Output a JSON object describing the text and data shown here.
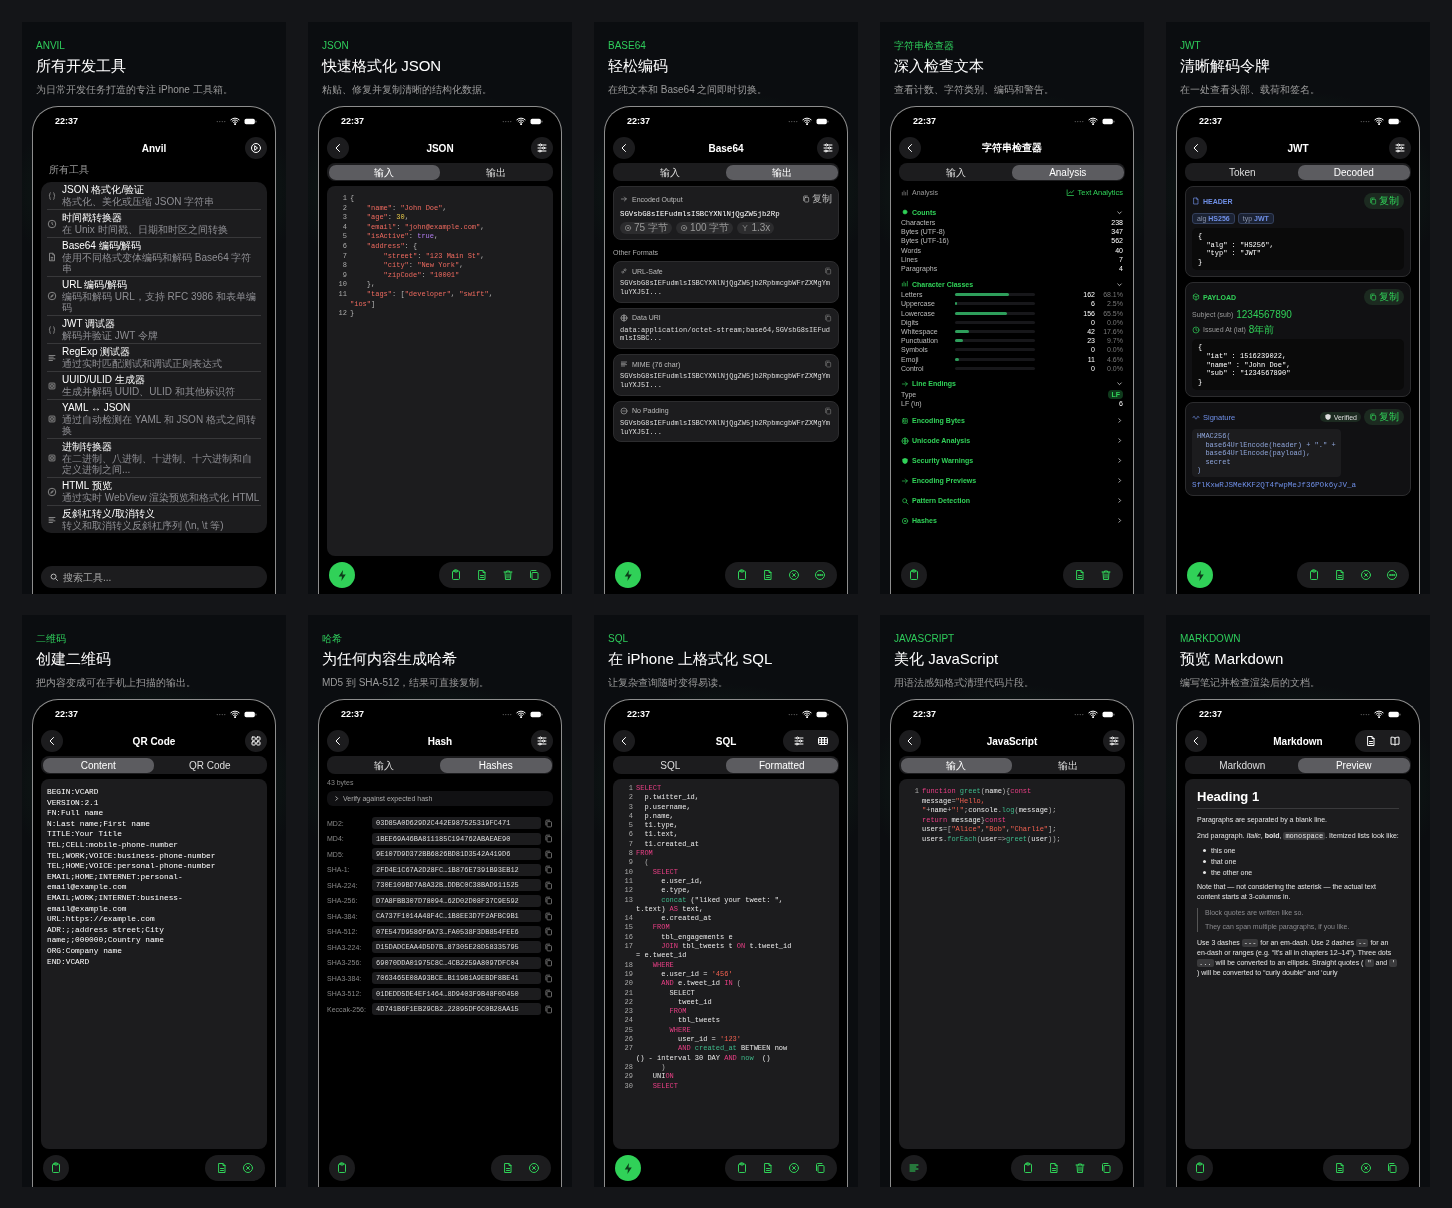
{
  "panels": [
    {
      "kind": "tools",
      "eyebrow": "ANVIL",
      "title": "所有开发工具",
      "subtitle": "为日常开发任务打造的专注 iPhone 工具箱。",
      "phone": {
        "time": "22:37",
        "title": "Anvil",
        "section": "所有工具",
        "tools": [
          {
            "title": "JSON 格式化/验证",
            "subtitle": "格式化、美化或压缩 JSON 字符串"
          },
          {
            "title": "时间戳转换器",
            "subtitle": "在 Unix 时间戳、日期和时区之间转换"
          },
          {
            "title": "Base64 编码/解码",
            "subtitle": "使用不同格式变体编码和解码 Base64 字符串"
          },
          {
            "title": "URL 编码/解码",
            "subtitle": "编码和解码 URL，支持 RFC 3986 和表单编码"
          },
          {
            "title": "JWT 调试器",
            "subtitle": "解码并验证 JWT 令牌"
          },
          {
            "title": "RegExp 测试器",
            "subtitle": "通过实时匹配测试和调试正则表达式"
          },
          {
            "title": "UUID/ULID 生成器",
            "subtitle": "生成并解码 UUID、ULID 和其他标识符"
          },
          {
            "title": "YAML ↔ JSON",
            "subtitle": "通过自动检测在 YAML 和 JSON 格式之间转换"
          },
          {
            "title": "进制转换器",
            "subtitle": "在二进制、八进制、十进制、十六进制和自定义进制之间..."
          },
          {
            "title": "HTML 预览",
            "subtitle": "通过实时 WebView 渲染预览和格式化 HTML"
          },
          {
            "title": "反斜杠转义/取消转义",
            "subtitle": "转义和取消转义反斜杠序列 (\\n, \\t 等)"
          }
        ],
        "search": {
          "placeholder": "搜索工具..."
        }
      }
    },
    {
      "kind": "json",
      "eyebrow": "JSON",
      "title": "快速格式化 JSON",
      "subtitle": "粘贴、修复并复制清晰的结构化数据。",
      "phone": {
        "time": "22:37",
        "title": "JSON",
        "tabs": [
          {
            "label": "输入",
            "selected": true
          },
          {
            "label": "输出",
            "selected": false
          }
        ],
        "code": [
          {
            "n": "1",
            "tokens": [
              {
                "kind": "punc",
                "text": "{"
              }
            ]
          },
          {
            "n": "2",
            "tokens": [
              {
                "kind": "key",
                "text": "    \"name\""
              },
              {
                "kind": "punc",
                "text": ": "
              },
              {
                "kind": "str",
                "text": "\"John Doe\""
              },
              {
                "kind": "punc",
                "text": ","
              }
            ]
          },
          {
            "n": "3",
            "tokens": [
              {
                "kind": "key",
                "text": "    \"age\""
              },
              {
                "kind": "punc",
                "text": ": "
              },
              {
                "kind": "num",
                "text": "30"
              },
              {
                "kind": "punc",
                "text": ","
              }
            ]
          },
          {
            "n": "4",
            "tokens": [
              {
                "kind": "key",
                "text": "    \"email\""
              },
              {
                "kind": "punc",
                "text": ": "
              },
              {
                "kind": "str",
                "text": "\"john@example.com\""
              },
              {
                "kind": "punc",
                "text": ","
              }
            ]
          },
          {
            "n": "5",
            "tokens": [
              {
                "kind": "key",
                "text": "    \"isActive\""
              },
              {
                "kind": "punc",
                "text": ": "
              },
              {
                "kind": "bool",
                "text": "true"
              },
              {
                "kind": "punc",
                "text": ","
              }
            ]
          },
          {
            "n": "6",
            "tokens": [
              {
                "kind": "key",
                "text": "    \"address\""
              },
              {
                "kind": "punc",
                "text": ": {"
              }
            ]
          },
          {
            "n": "7",
            "tokens": [
              {
                "kind": "key",
                "text": "        \"street\""
              },
              {
                "kind": "punc",
                "text": ": "
              },
              {
                "kind": "str",
                "text": "\"123 Main St\""
              },
              {
                "kind": "punc",
                "text": ","
              }
            ]
          },
          {
            "n": "8",
            "tokens": [
              {
                "kind": "key",
                "text": "        \"city\""
              },
              {
                "kind": "punc",
                "text": ": "
              },
              {
                "kind": "str",
                "text": "\"New York\""
              },
              {
                "kind": "punc",
                "text": ","
              }
            ]
          },
          {
            "n": "9",
            "tokens": [
              {
                "kind": "key",
                "text": "        \"zipCode\""
              },
              {
                "kind": "punc",
                "text": ": "
              },
              {
                "kind": "str",
                "text": "\"10001\""
              }
            ]
          },
          {
            "n": "10",
            "tokens": [
              {
                "kind": "punc",
                "text": "    },"
              }
            ]
          },
          {
            "n": "11",
            "tokens": [
              {
                "kind": "key",
                "text": "    \"tags\""
              },
              {
                "kind": "punc",
                "text": ": ["
              },
              {
                "kind": "str",
                "text": "\"developer\""
              },
              {
                "kind": "punc",
                "text": ", "
              },
              {
                "kind": "str",
                "text": "\"swift\""
              },
              {
                "kind": "punc",
                "text": ","
              }
            ]
          },
          {
            "tokens": [
              {
                "kind": "str",
                "text": "\"ios\""
              },
              {
                "kind": "punc",
                "text": "]"
              }
            ]
          },
          {
            "n": "12",
            "tokens": [
              {
                "kind": "punc",
                "text": "}"
              }
            ]
          }
        ]
      }
    },
    {
      "kind": "base64",
      "eyebrow": "BASE64",
      "title": "轻松编码",
      "subtitle": "在纯文本和 Base64 之间即时切换。",
      "phone": {
        "time": "22:37",
        "title": "Base64",
        "tabs": [
          {
            "label": "输入",
            "selected": false
          },
          {
            "label": "输出",
            "selected": true
          }
        ],
        "output": {
          "label": "Encoded Output",
          "copy": "复制",
          "value": "SGVsbG8sIEFudmlsISBCYXNlNjQgZW5jb2Rp",
          "chips": [
            "75 字节",
            "100 字节",
            "1.3x"
          ]
        },
        "section": "Other Formats",
        "formats": [
          {
            "label": "URL-Safe",
            "value": "SGVsbG8sIEFudmlsISBCYXNlNjQgZW5jb2RpbmcgbWFrZXMgYmluYXJ5I..."
          },
          {
            "label": "Data URI",
            "value": "data:application/octet-stream;base64,SGVsbG8sIEFudmlsISBC..."
          },
          {
            "label": "MIME (76 char)",
            "value": "SGVsbG8sIEFudmlsISBCYXNlNjQgZW5jb2RpbmcgbWFrZXMgYmluYXJ5I..."
          },
          {
            "label": "No Padding",
            "value": "SGVsbG8sIEFudmlsISBCYXNlNjQgZW5jb2RpbmcgbWFrZXMgYmluYXJ5I..."
          }
        ]
      }
    },
    {
      "kind": "inspector",
      "eyebrow": "字符串检查器",
      "title": "深入检查文本",
      "subtitle": "查看计数、字符类别、编码和警告。",
      "phone": {
        "time": "22:37",
        "title": "字符串检查器",
        "tabs": [
          {
            "label": "输入",
            "selected": false
          },
          {
            "label": "Analysis",
            "selected": true
          }
        ],
        "header": {
          "label": "Analysis",
          "action": "Text Analytics"
        },
        "sections": [
          {
            "kind": "counts",
            "title": "Counts",
            "expanded": true,
            "rows": [
              {
                "label": "Characters",
                "value": "238"
              },
              {
                "label": "Bytes (UTF-8)",
                "value": "347"
              },
              {
                "label": "Bytes (UTF-16)",
                "value": "562"
              },
              {
                "label": "Words",
                "value": "40"
              },
              {
                "label": "Lines",
                "value": "7"
              },
              {
                "label": "Paragraphs",
                "value": "4"
              }
            ]
          },
          {
            "kind": "classes",
            "title": "Character Classes",
            "expanded": true,
            "rows": [
              {
                "label": "Letters",
                "count": "162",
                "percent": "68.1%",
                "level": 0.681
              },
              {
                "label": "Uppercase",
                "count": "6",
                "percent": "2.5%",
                "level": 0.025
              },
              {
                "label": "Lowercase",
                "count": "156",
                "percent": "65.5%",
                "level": 0.655
              },
              {
                "label": "Digits",
                "count": "0",
                "percent": "0.0%"
              },
              {
                "label": "Whitespace",
                "count": "42",
                "percent": "17.6%",
                "level": 0.176
              },
              {
                "label": "Punctuation",
                "count": "23",
                "percent": "9.7%",
                "level": 0.097
              },
              {
                "label": "Symbols",
                "count": "0",
                "percent": "0.0%"
              },
              {
                "label": "Emoji",
                "count": "11",
                "percent": "4.6%",
                "level": 0.046
              },
              {
                "label": "Control",
                "count": "0",
                "percent": "0.0%"
              }
            ]
          },
          {
            "kind": "endings",
            "title": "Line Endings",
            "expanded": true,
            "rows": [
              {
                "kind": "badge",
                "label": "Type",
                "value": "LF"
              },
              {
                "kind": "value",
                "label": "LF (\\n)",
                "value": "6"
              }
            ]
          },
          {
            "kind": "more",
            "title": "Encoding Bytes",
            "expanded": false
          },
          {
            "kind": "more",
            "title": "Unicode Analysis",
            "expanded": false
          },
          {
            "kind": "more",
            "title": "Security Warnings",
            "expanded": false
          },
          {
            "kind": "more",
            "title": "Encoding Previews",
            "expanded": false
          },
          {
            "kind": "more",
            "title": "Pattern Detection",
            "expanded": false
          },
          {
            "kind": "more",
            "title": "Hashes",
            "expanded": false
          }
        ]
      }
    },
    {
      "kind": "jwt",
      "eyebrow": "JWT",
      "title": "清晰解码令牌",
      "subtitle": "在一处查看头部、载荷和签名。",
      "phone": {
        "time": "22:37",
        "title": "JWT",
        "tabs": [
          {
            "label": "Token",
            "selected": false
          },
          {
            "label": "Decoded",
            "selected": true
          }
        ],
        "cards": [
          {
            "kind": "header",
            "title": "HEADER",
            "copy": "复制",
            "chips": [
              {
                "key": "alg",
                "value": "HS256"
              },
              {
                "key": "typ",
                "value": "JWT"
              }
            ],
            "code": [
              "{",
              "  \"alg\" : \"HS256\",",
              "  \"typ\" : \"JWT\"",
              "}"
            ]
          },
          {
            "kind": "payload",
            "title": "PAYLOAD",
            "copy": "复制",
            "claims": [
              {
                "kind": "plain",
                "label": "Subject (sub)",
                "value": "1234567890"
              },
              {
                "kind": "time",
                "label": "Issued At (iat)",
                "value": "8年前"
              }
            ],
            "code": [
              "{",
              "  \"iat\" : 1516239022,",
              "  \"name\" : \"John Doe\",",
              "  \"sub\" : \"1234567890\"",
              "}"
            ]
          },
          {
            "kind": "signature",
            "title": "Signature",
            "badge": "Verified",
            "copy": "复制",
            "formula": [
              "HMAC256(",
              "  base64UrlEncode(header) + \".\" +",
              "  base64UrlEncode(payload),",
              "  secret",
              ")"
            ],
            "signature": "SflKxwRJSMeKKF2QT4fwpMeJf36POk6yJV_a"
          }
        ]
      }
    },
    {
      "kind": "qr",
      "eyebrow": "二维码",
      "title": "创建二维码",
      "subtitle": "把内容变成可在手机上扫描的输出。",
      "phone": {
        "time": "22:37",
        "title": "QR Code",
        "tabs": [
          {
            "label": "Content",
            "selected": true
          },
          {
            "label": "QR Code",
            "selected": false
          }
        ],
        "text": [
          "BEGIN:VCARD",
          "VERSION:2.1",
          "FN:Full name",
          "N:Last name;First name",
          "TITLE:Your Title",
          "TEL;CELL:mobile-phone-number",
          "TEL;WORK;VOICE:business-phone-number",
          "TEL;HOME;VOICE:personal-phone-number",
          "EMAIL;HOME;INTERNET:personal-",
          "email@example.com",
          "EMAIL;WORK;INTERNET:business-",
          "email@example.com",
          "URL:https://example.com",
          "ADR:;;address street;City",
          "name;;000000;Country name",
          "ORG:Company name",
          "END:VCARD"
        ]
      }
    },
    {
      "kind": "hash",
      "eyebrow": "哈希",
      "title": "为任何内容生成哈希",
      "subtitle": "MD5 到 SHA-512，结果可直接复制。",
      "phone": {
        "time": "22:37",
        "title": "Hash",
        "tabs": [
          {
            "label": "输入",
            "selected": false
          },
          {
            "label": "Hashes",
            "selected": true
          }
        ],
        "size": "43 bytes",
        "verify": {
          "label": "Verify against expected hash",
          "expanded": false
        },
        "hashes": [
          {
            "algorithm": "MD2:",
            "value": "03D85A0D629D2C442E987525319FC471"
          },
          {
            "algorithm": "MD4:",
            "value": "1BEE69A46BA811185C194762ABAEAE90"
          },
          {
            "algorithm": "MD5:",
            "value": "9E107D9D372BB6826BD81D3542A419D6"
          },
          {
            "algorithm": "SHA-1:",
            "value": "2FD4E1C67A2D28FC…1B876E7391B93EB12"
          },
          {
            "algorithm": "SHA-224:",
            "value": "730E109BD7A8A32B…DDBC0C38BAD911525"
          },
          {
            "algorithm": "SHA-256:",
            "value": "D7A8FBB307D78094…62D02D08F37C9E592"
          },
          {
            "algorithm": "SHA-384:",
            "value": "CA737F1014A48F4C…1B8EE3D7F2AFBC9B1"
          },
          {
            "algorithm": "SHA-512:",
            "value": "07E547D9586F6A73…FA0538F3DB854FEE6"
          },
          {
            "algorithm": "SHA3-224:",
            "value": "D15DADCEAA4D5D7B…87305E28D58335795"
          },
          {
            "algorithm": "SHA3-256:",
            "value": "69070DDA01975C8C…4CB2259A8097DFC04"
          },
          {
            "algorithm": "SHA3-384:",
            "value": "7063465E08A93BCE…B119B1A9EBDF8BE41"
          },
          {
            "algorithm": "SHA3-512:",
            "value": "01DEDD5DE4EF1464…8D9403F9B48F0D450"
          },
          {
            "algorithm": "Keccak-256:",
            "value": "4D741B6F1EB29CB2…22895DF6C0B28AA15"
          }
        ]
      }
    },
    {
      "kind": "sql",
      "eyebrow": "SQL",
      "title": "在 iPhone 上格式化 SQL",
      "subtitle": "让复杂查询随时变得易读。",
      "phone": {
        "time": "22:37",
        "title": "SQL",
        "tabs": [
          {
            "label": "SQL",
            "selected": false
          },
          {
            "label": "Formatted",
            "selected": true
          }
        ],
        "code": [
          {
            "n": "1",
            "tokens": [
              {
                "kind": "kw",
                "text": "SELECT"
              }
            ]
          },
          {
            "n": "2",
            "tokens": [
              {
                "kind": "plain",
                "text": "  p.twitter_id,"
              }
            ]
          },
          {
            "n": "3",
            "tokens": [
              {
                "kind": "plain",
                "text": "  p.username,"
              }
            ]
          },
          {
            "n": "4",
            "tokens": [
              {
                "kind": "plain",
                "text": "  p.name,"
              }
            ]
          },
          {
            "n": "5",
            "tokens": [
              {
                "kind": "plain",
                "text": "  t1.type,"
              }
            ]
          },
          {
            "n": "6",
            "tokens": [
              {
                "kind": "plain",
                "text": "  t1.text,"
              }
            ]
          },
          {
            "n": "7",
            "tokens": [
              {
                "kind": "plain",
                "text": "  t1.created_at"
              }
            ]
          },
          {
            "n": "8",
            "tokens": [
              {
                "kind": "kw",
                "text": "FROM"
              }
            ]
          },
          {
            "n": "9",
            "tokens": [
              {
                "kind": "punc",
                "text": "  ("
              }
            ]
          },
          {
            "n": "10",
            "tokens": [
              {
                "kind": "kw",
                "text": "    SELECT"
              }
            ]
          },
          {
            "n": "11",
            "tokens": [
              {
                "kind": "plain",
                "text": "      e.user_id,"
              }
            ]
          },
          {
            "n": "12",
            "tokens": [
              {
                "kind": "plain",
                "text": "      e.type,"
              }
            ]
          },
          {
            "n": "13",
            "tokens": [
              {
                "kind": "fn",
                "text": "      concat"
              },
              {
                "kind": "plain",
                "text": " (\"liked your tweet: \","
              }
            ]
          },
          {
            "tokens": [
              {
                "kind": "plain",
                "text": "t.text) "
              },
              {
                "kind": "kw",
                "text": "AS"
              },
              {
                "kind": "plain",
                "text": " text,"
              }
            ]
          },
          {
            "n": "14",
            "tokens": [
              {
                "kind": "plain",
                "text": "      e.created_at"
              }
            ]
          },
          {
            "n": "15",
            "tokens": [
              {
                "kind": "kw",
                "text": "    FROM"
              }
            ]
          },
          {
            "n": "16",
            "tokens": [
              {
                "kind": "plain",
                "text": "      tbl_engagements e"
              }
            ]
          },
          {
            "n": "17",
            "tokens": [
              {
                "kind": "kw",
                "text": "      JOIN"
              },
              {
                "kind": "plain",
                "text": " tbl_tweets t "
              },
              {
                "kind": "kw",
                "text": "ON"
              },
              {
                "kind": "plain",
                "text": " t.tweet_id"
              }
            ]
          },
          {
            "tokens": [
              {
                "kind": "plain",
                "text": "= e.tweet_id"
              }
            ]
          },
          {
            "n": "18",
            "tokens": [
              {
                "kind": "kw",
                "text": "    WHERE"
              }
            ]
          },
          {
            "n": "19",
            "tokens": [
              {
                "kind": "plain",
                "text": "      e.user_id = "
              },
              {
                "kind": "sqlstr",
                "text": "'456'"
              }
            ]
          },
          {
            "n": "20",
            "tokens": [
              {
                "kind": "kw",
                "text": "      AND"
              },
              {
                "kind": "plain",
                "text": " e.tweet_id "
              },
              {
                "kind": "kw",
                "text": "IN"
              },
              {
                "kind": "punc",
                "text": " ("
              }
            ]
          },
          {
            "n": "21",
            "tokens": [
              {
                "kind": "plain",
                "text": "        SELECT"
              }
            ]
          },
          {
            "n": "22",
            "tokens": [
              {
                "kind": "plain",
                "text": "          tweet_id"
              }
            ]
          },
          {
            "n": "23",
            "tokens": [
              {
                "kind": "kw",
                "text": "        FROM"
              }
            ]
          },
          {
            "n": "24",
            "tokens": [
              {
                "kind": "plain",
                "text": "          tbl_tweets"
              }
            ]
          },
          {
            "n": "25",
            "tokens": [
              {
                "kind": "kw",
                "text": "        WHERE"
              }
            ]
          },
          {
            "n": "26",
            "tokens": [
              {
                "kind": "plain",
                "text": "          user_id = "
              },
              {
                "kind": "sqlstr",
                "text": "'123'"
              }
            ]
          },
          {
            "n": "27",
            "tokens": [
              {
                "kind": "kw",
                "text": "          AND"
              },
              {
                "kind": "fn",
                "text": " created_at"
              },
              {
                "kind": "plain",
                "text": " BETWEEN now"
              }
            ]
          },
          {
            "tokens": [
              {
                "kind": "plain",
                "text": "() - interval 30 DAY "
              },
              {
                "kind": "kw",
                "text": "AND"
              },
              {
                "kind": "fn",
                "text": " now"
              },
              {
                "kind": "plain",
                "text": "  ()"
              }
            ]
          },
          {
            "n": "28",
            "tokens": [
              {
                "kind": "punc",
                "text": "      )"
              }
            ]
          },
          {
            "n": "29",
            "tokens": [
              {
                "kind": "plain",
                "text": "    UNI"
              },
              {
                "kind": "kw",
                "text": "ON"
              }
            ]
          },
          {
            "n": "30",
            "tokens": [
              {
                "kind": "kw",
                "text": "    SELECT"
              }
            ]
          }
        ]
      }
    },
    {
      "kind": "js",
      "eyebrow": "JAVASCRIPT",
      "title": "美化 JavaScript",
      "subtitle": "用语法感知格式清理代码片段。",
      "phone": {
        "time": "22:37",
        "title": "JavaScript",
        "tabs": [
          {
            "label": "输入",
            "selected": true
          },
          {
            "label": "输出",
            "selected": false
          }
        ],
        "code": [
          {
            "n": "1",
            "tokens": [
              {
                "kind": "kw",
                "text": "function"
              },
              {
                "kind": "fn",
                "text": " greet"
              },
              {
                "kind": "punc",
                "text": "("
              },
              {
                "kind": "plain",
                "text": "name"
              },
              {
                "kind": "punc",
                "text": "){"
              },
              {
                "kind": "kw",
                "text": "const"
              }
            ]
          },
          {
            "tokens": [
              {
                "kind": "plain",
                "text": "message"
              },
              {
                "kind": "punc",
                "text": "="
              },
              {
                "kind": "sqlstr",
                "text": "\"Hello,"
              }
            ]
          },
          {
            "tokens": [
              {
                "kind": "sqlstr",
                "text": "\""
              },
              {
                "kind": "punc",
                "text": "+"
              },
              {
                "kind": "plain",
                "text": "name"
              },
              {
                "kind": "punc",
                "text": "+"
              },
              {
                "kind": "sqlstr",
                "text": "\"!\""
              },
              {
                "kind": "punc",
                "text": ";"
              },
              {
                "kind": "plain",
                "text": "console"
              },
              {
                "kind": "punc",
                "text": "."
              },
              {
                "kind": "fn",
                "text": "log"
              },
              {
                "kind": "punc",
                "text": "("
              },
              {
                "kind": "plain",
                "text": "message"
              },
              {
                "kind": "punc",
                "text": ");"
              }
            ]
          },
          {
            "tokens": [
              {
                "kind": "kw",
                "text": "return"
              },
              {
                "kind": "plain",
                "text": " message"
              },
              {
                "kind": "punc",
                "text": "}"
              },
              {
                "kind": "kw",
                "text": "const"
              }
            ]
          },
          {
            "tokens": [
              {
                "kind": "plain",
                "text": "users"
              },
              {
                "kind": "punc",
                "text": "=["
              },
              {
                "kind": "sqlstr",
                "text": "\"Alice\""
              },
              {
                "kind": "punc",
                "text": ","
              },
              {
                "kind": "sqlstr",
                "text": "\"Bob\""
              },
              {
                "kind": "punc",
                "text": ","
              },
              {
                "kind": "sqlstr",
                "text": "\"Charlie\""
              },
              {
                "kind": "punc",
                "text": "];"
              }
            ]
          },
          {
            "tokens": [
              {
                "kind": "plain",
                "text": "users"
              },
              {
                "kind": "punc",
                "text": "."
              },
              {
                "kind": "fn",
                "text": "forEach"
              },
              {
                "kind": "punc",
                "text": "("
              },
              {
                "kind": "plain",
                "text": "user"
              },
              {
                "kind": "punc",
                "text": "=>"
              },
              {
                "kind": "fn",
                "text": "greet"
              },
              {
                "kind": "punc",
                "text": "("
              },
              {
                "kind": "plain",
                "text": "user"
              },
              {
                "kind": "punc",
                "text": "));"
              }
            ]
          }
        ]
      }
    },
    {
      "kind": "markdown",
      "eyebrow": "MARKDOWN",
      "title": "预览 Markdown",
      "subtitle": "编写笔记并检查渲染后的文档。",
      "phone": {
        "time": "22:37",
        "title": "Markdown",
        "tabs": [
          {
            "label": "Markdown",
            "selected": false
          },
          {
            "label": "Preview",
            "selected": true
          }
        ],
        "preview": [
          {
            "kind": "heading",
            "text": "Heading 1"
          },
          {
            "kind": "paragraph",
            "spans": [
              {
                "kind": "text",
                "text": "Paragraphs are separated by a blank line."
              }
            ]
          },
          {
            "kind": "paragraph",
            "spans": [
              {
                "kind": "text",
                "text": "2nd paragraph. "
              },
              {
                "kind": "italic",
                "text": "Italic"
              },
              {
                "kind": "text",
                "text": ", "
              },
              {
                "kind": "bold",
                "text": "bold"
              },
              {
                "kind": "text",
                "text": ", "
              },
              {
                "kind": "code",
                "text": "monospace"
              },
              {
                "kind": "text",
                "text": ". Itemized lists look like:"
              }
            ]
          },
          {
            "kind": "list",
            "items": [
              "this one",
              "that one",
              "the other one"
            ]
          },
          {
            "kind": "paragraph",
            "spans": [
              {
                "kind": "text",
                "text": "Note that — not considering the asterisk — the actual text content starts at 3-columns in."
              }
            ]
          },
          {
            "kind": "quote",
            "paragraphs": [
              "Block quotes are written like so.",
              "They can span multiple paragraphs, if you like."
            ]
          },
          {
            "kind": "paragraph",
            "spans": [
              {
                "kind": "text",
                "text": "Use 3 dashes "
              },
              {
                "kind": "code",
                "text": "---"
              },
              {
                "kind": "text",
                "text": " for an em-dash. Use 2 dashes "
              },
              {
                "kind": "code",
                "text": "--"
              },
              {
                "kind": "text",
                "text": " for an en-dash or ranges (e.g. “It's all in chapters 12–14”). Three dots "
              },
              {
                "kind": "code",
                "text": "..."
              },
              {
                "kind": "text",
                "text": " will be converted to an ellipsis. Straight quotes ( "
              },
              {
                "kind": "code",
                "text": "\""
              },
              {
                "kind": "text",
                "text": " and "
              },
              {
                "kind": "code",
                "text": "'"
              },
              {
                "kind": "text",
                "text": " ) will be converted to “curly double” and ‘curly"
              }
            ]
          }
        ]
      }
    }
  ]
}
